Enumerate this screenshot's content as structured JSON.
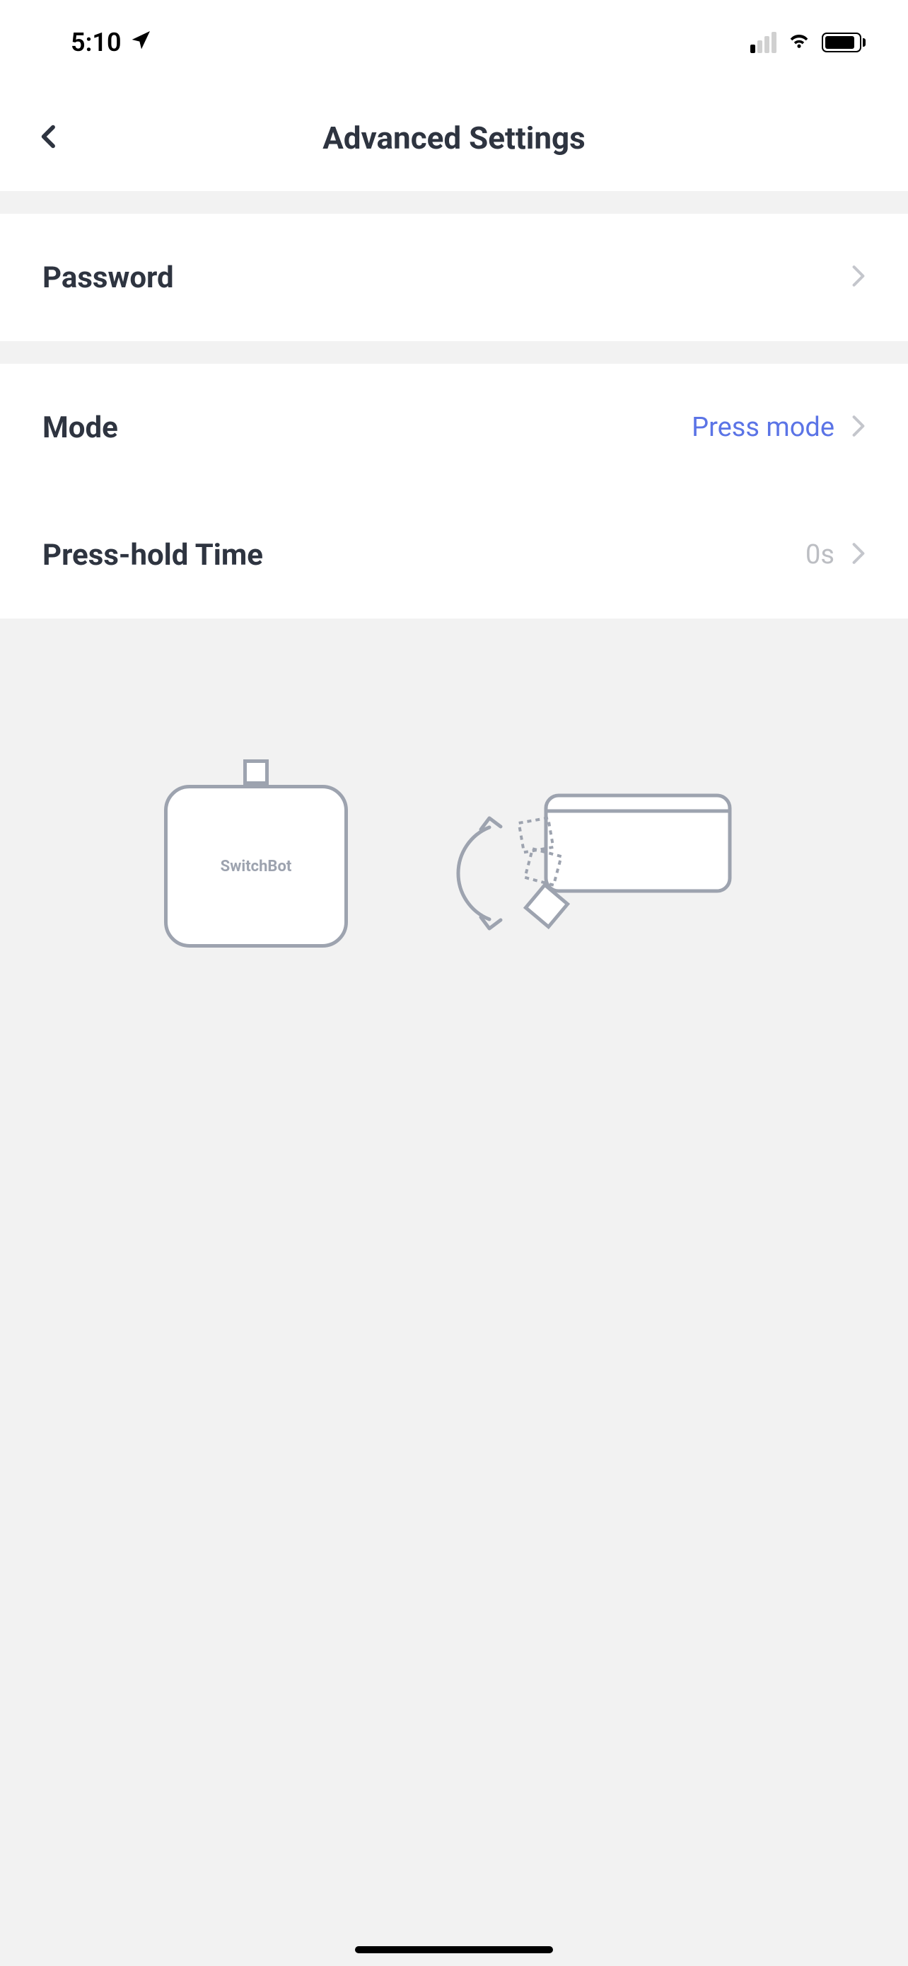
{
  "statusBar": {
    "time": "5:10"
  },
  "header": {
    "title": "Advanced Settings"
  },
  "rows": {
    "password": {
      "label": "Password"
    },
    "mode": {
      "label": "Mode",
      "value": "Press mode"
    },
    "pressHold": {
      "label": "Press-hold Time",
      "value": "0s"
    }
  },
  "illustration": {
    "deviceLabel": "SwitchBot"
  }
}
